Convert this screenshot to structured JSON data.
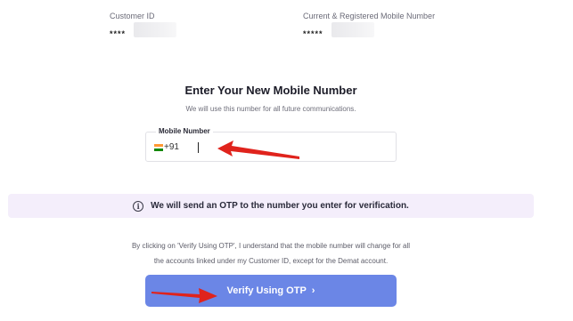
{
  "customer": {
    "id_label": "Customer ID",
    "id_value": "****",
    "mobile_label": "Current & Registered Mobile Number",
    "mobile_value": "*****"
  },
  "form": {
    "title": "Enter Your New Mobile Number",
    "subtitle": "We will use this number for all future communications.",
    "field_label": "Mobile Number",
    "country_code": "+91",
    "flag": "india-flag-icon",
    "input_value": ""
  },
  "otp_notice": {
    "icon": "info-icon",
    "text": "We will send an OTP to the number you enter for verification."
  },
  "disclaimer": {
    "line1": "By clicking on 'Verify Using OTP', I understand that the mobile number will change for all",
    "line2": "the accounts linked under my Customer ID, except for the Demat account."
  },
  "verify_button": {
    "label": "Verify Using OTP",
    "icon": "chevron-right-icon",
    "color": "#6b86e6"
  },
  "colors": {
    "banner_bg": "#f4eefb",
    "annotation_arrow": "#e0231c"
  }
}
